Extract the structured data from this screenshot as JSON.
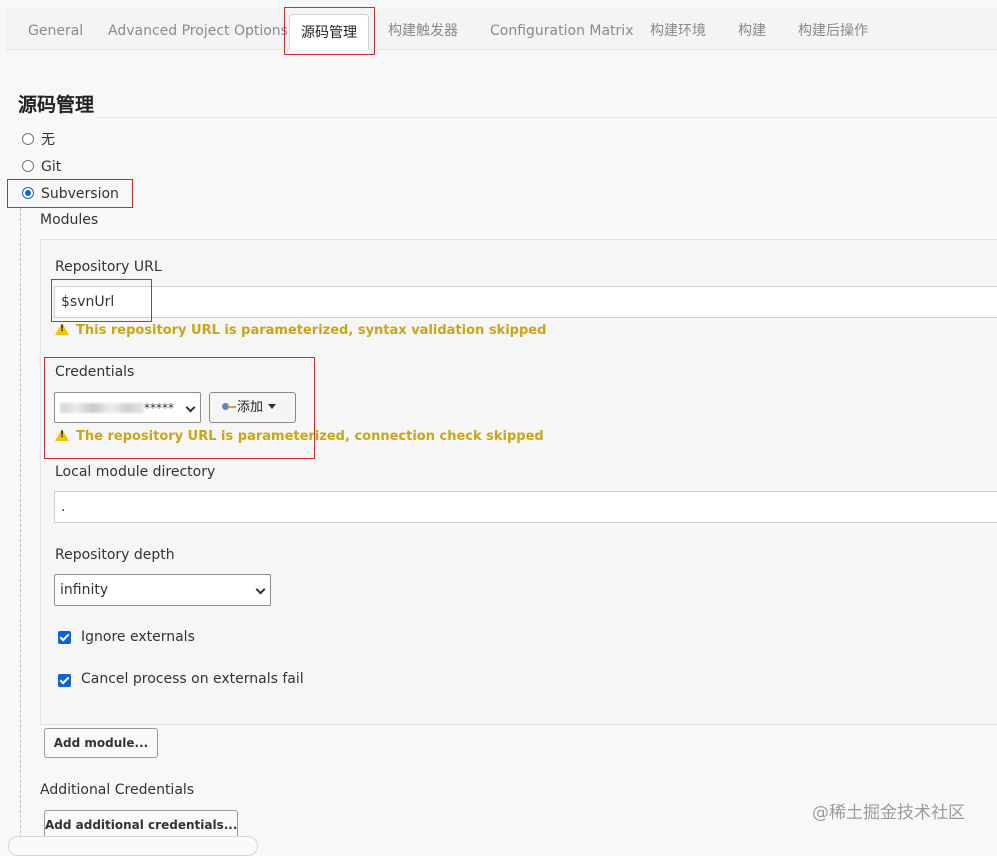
{
  "tabs": [
    {
      "label": "General"
    },
    {
      "label": "Advanced Project Options"
    },
    {
      "label": "源码管理"
    },
    {
      "label": "构建触发器"
    },
    {
      "label": "Configuration Matrix"
    },
    {
      "label": "构建环境"
    },
    {
      "label": "构建"
    },
    {
      "label": "构建后操作"
    }
  ],
  "section_title": "源码管理",
  "scm_options": [
    {
      "label": "无",
      "checked": false
    },
    {
      "label": "Git",
      "checked": false
    },
    {
      "label": "Subversion",
      "checked": true
    }
  ],
  "modules_label": "Modules",
  "repository_url": {
    "label": "Repository URL",
    "value": "$svnUrl",
    "warning": "This repository URL is parameterized, syntax validation skipped"
  },
  "credentials": {
    "label": "Credentials",
    "selected_suffix": "*****",
    "add_button": "添加",
    "warning": "The repository URL is parameterized, connection check skipped"
  },
  "local_module_directory": {
    "label": "Local module directory",
    "value": "."
  },
  "repository_depth": {
    "label": "Repository depth",
    "selected": "infinity"
  },
  "checkboxes": [
    {
      "label": "Ignore externals",
      "checked": true
    },
    {
      "label": "Cancel process on externals fail",
      "checked": true
    }
  ],
  "add_module_button": "Add module...",
  "additional_credentials": {
    "label": "Additional Credentials",
    "button": "Add additional credentials..."
  },
  "watermark": "@稀土掘金技术社区",
  "colors": {
    "accent": "#0b63d6",
    "highlight_box": "#d9262c",
    "warning_text": "#c9a51a"
  }
}
